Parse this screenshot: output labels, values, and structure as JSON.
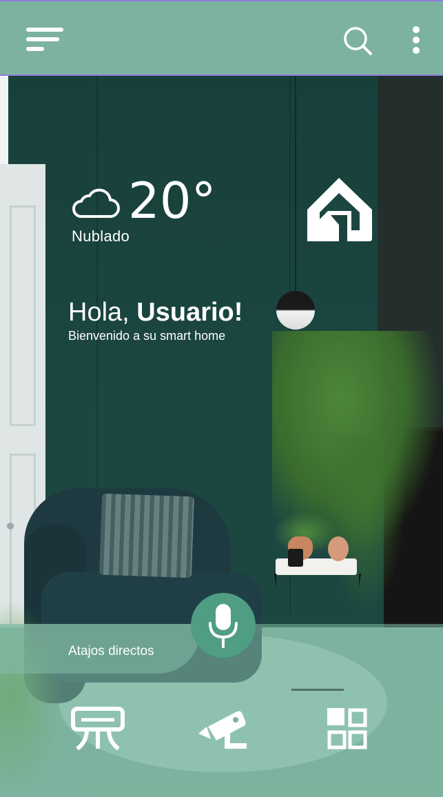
{
  "topbar": {
    "menu_icon": "hamburger-menu-icon",
    "search_icon": "search-icon",
    "more_icon": "more-vertical-icon"
  },
  "weather": {
    "icon": "cloud-icon",
    "temperature": "20°",
    "condition": "Nublado"
  },
  "brand": {
    "logo_icon": "smart-home-logo-icon"
  },
  "greeting": {
    "hello": "Hola, ",
    "user": "Usuario!",
    "subtitle": "Bienvenido a su smart home"
  },
  "shortcuts": {
    "label": "Atajos directos",
    "mic_icon": "microphone-icon",
    "items": [
      {
        "icon": "air-conditioner-icon"
      },
      {
        "icon": "security-camera-icon"
      },
      {
        "icon": "apps-grid-icon"
      }
    ]
  },
  "colors": {
    "topbar": "#7db39e",
    "topbar_border": "#8f7ae0",
    "mic_button": "#4f9e83",
    "panel_overlay": "#84bca6",
    "text": "#ffffff"
  }
}
